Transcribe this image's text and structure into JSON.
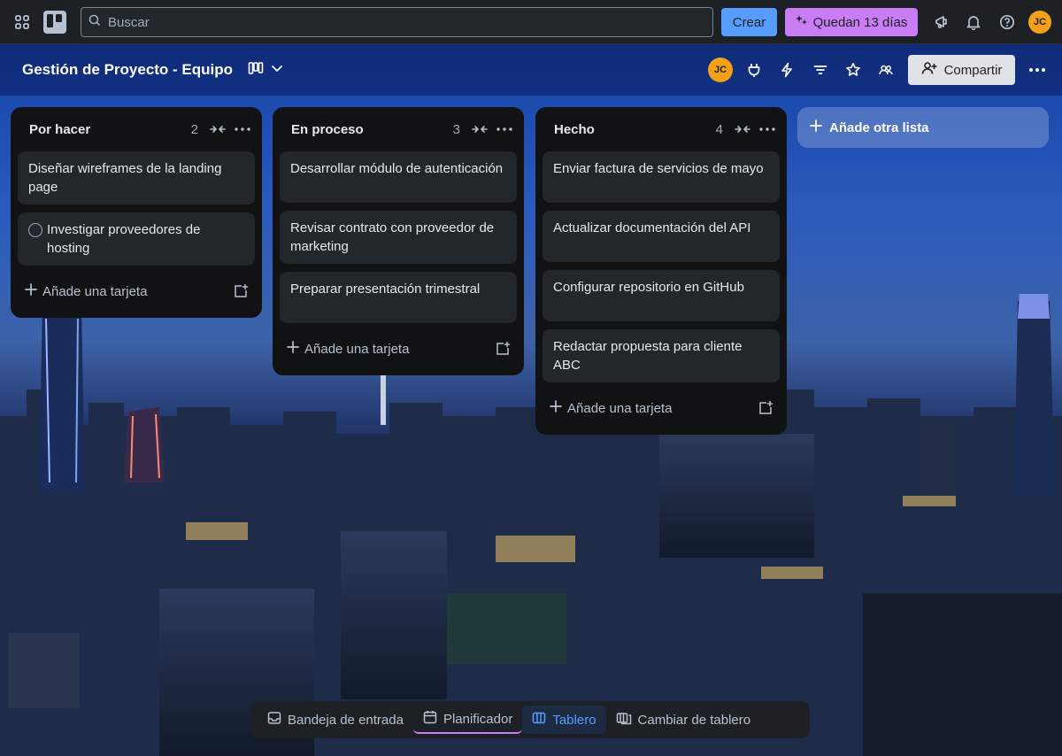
{
  "topbar": {
    "search_placeholder": "Buscar",
    "create_label": "Crear",
    "trial_label": "Quedan 13 días",
    "avatar_initials": "JC"
  },
  "board": {
    "title": "Gestión de Proyecto - Equipo",
    "member_initials": "JC",
    "share_label": "Compartir"
  },
  "lists": [
    {
      "title": "Por hacer",
      "count": "2",
      "cards": [
        {
          "text": "Diseñar wireframes de la landing page",
          "checkbox": false
        },
        {
          "text": "Investigar proveedores de hosting",
          "checkbox": true
        }
      ],
      "add_label": "Añade una tarjeta"
    },
    {
      "title": "En proceso",
      "count": "3",
      "cards": [
        {
          "text": "Desarrollar módulo de autenticación",
          "checkbox": false
        },
        {
          "text": "Revisar contrato con proveedor de marketing",
          "checkbox": false
        },
        {
          "text": "Preparar presentación trimestral",
          "checkbox": false
        }
      ],
      "add_label": "Añade una tarjeta"
    },
    {
      "title": "Hecho",
      "count": "4",
      "cards": [
        {
          "text": "Enviar factura de servicios de mayo",
          "checkbox": false
        },
        {
          "text": "Actualizar documentación del API",
          "checkbox": false
        },
        {
          "text": "Configurar repositorio en GitHub",
          "checkbox": false
        },
        {
          "text": "Redactar propuesta para cliente ABC",
          "checkbox": false
        }
      ],
      "add_label": "Añade una tarjeta"
    }
  ],
  "add_list_label": "Añade otra lista",
  "bottom_nav": {
    "inbox": "Bandeja de entrada",
    "planner": "Planificador",
    "board": "Tablero",
    "switch": "Cambiar de tablero"
  },
  "colors": {
    "accent": "#579dff",
    "trial": "#c97cf4",
    "avatar": "#f5a01a"
  }
}
